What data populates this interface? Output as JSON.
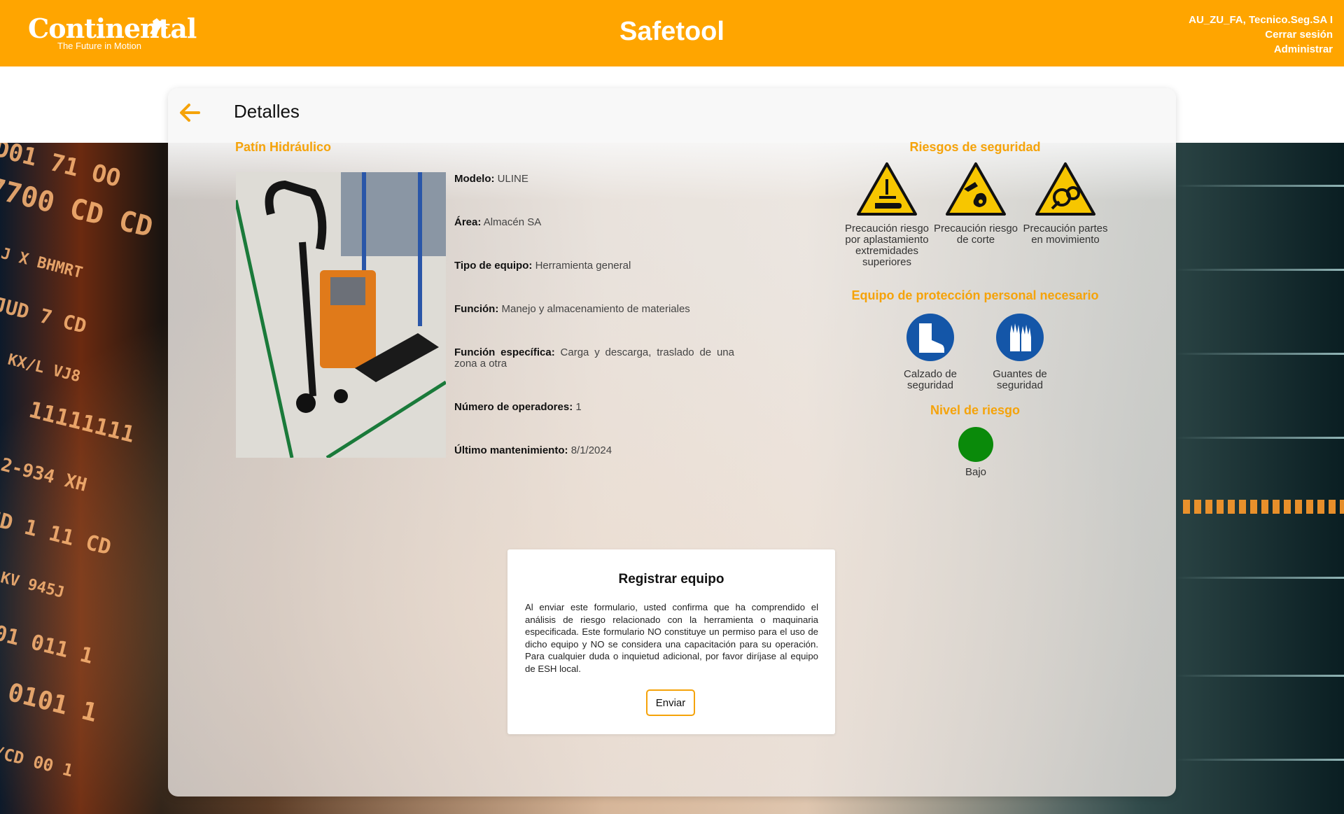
{
  "header": {
    "brand": "Continental",
    "tagline": "The Future in Motion",
    "app_title": "Safetool",
    "user": "AU_ZU_FA, Tecnico.Seg.SA I",
    "logout": "Cerrar sesión",
    "admin": "Administrar",
    "color": "#ffa500"
  },
  "page": {
    "title": "Detalles",
    "item_name": "Patín Hidráulico"
  },
  "fields": [
    {
      "label": "Modelo:",
      "value": "ULINE"
    },
    {
      "label": "Área:",
      "value": "Almacén SA"
    },
    {
      "label": "Tipo de equipo:",
      "value": "Herramienta general"
    },
    {
      "label": "Función:",
      "value": "Manejo y almacenamiento de materiales"
    },
    {
      "label": "Función específica:",
      "value": "Carga y descarga, traslado de una zona a otra"
    },
    {
      "label": "Número de operadores:",
      "value": "1"
    },
    {
      "label": "Último mantenimiento:",
      "value": "8/1/2024"
    }
  ],
  "risks": {
    "title": "Riesgos de seguridad",
    "items": [
      {
        "label": "Precaución riesgo por aplastamiento extremidades superiores",
        "icon": "hand-crush-warning-icon"
      },
      {
        "label": "Precaución riesgo de corte",
        "icon": "cut-warning-icon"
      },
      {
        "label": "Precaución partes en movimiento",
        "icon": "moving-parts-warning-icon"
      }
    ]
  },
  "ppe": {
    "title": "Equipo de protección personal necesario",
    "items": [
      {
        "label": "Calzado de seguridad",
        "icon": "safety-boots-icon"
      },
      {
        "label": "Guantes de seguridad",
        "icon": "safety-gloves-icon"
      }
    ]
  },
  "risk_level": {
    "title": "Nivel de riesgo",
    "value": "Bajo",
    "color": "#0a8a0a"
  },
  "register": {
    "title": "Registrar equipo",
    "text": "Al enviar este formulario, usted confirma que ha comprendido el análisis de riesgo relacionado con la herramienta o maquinaria especificada. Este formulario NO constituye un permiso para el uso de dicho equipo y NO se considera una capacitación para su operación. Para cualquier duda o inquietud adicional, por favor diríjase al equipo de ESH local.",
    "button": "Enviar"
  },
  "colors": {
    "accent": "#f5a30a",
    "warning_yellow": "#f7c600",
    "ppe_blue": "#1456a8"
  }
}
